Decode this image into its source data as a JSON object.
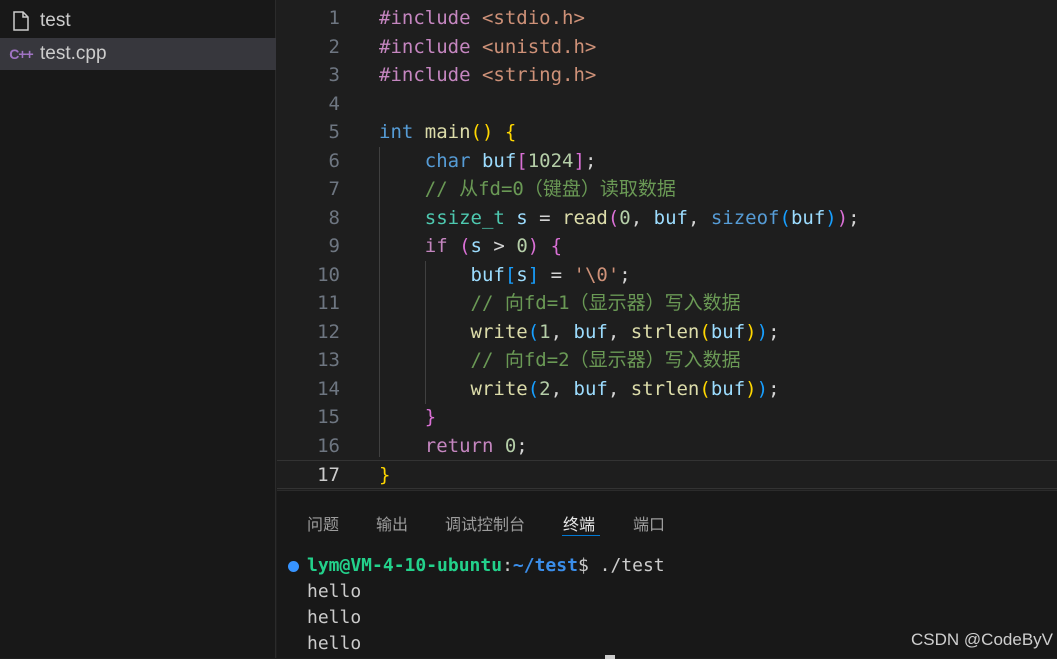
{
  "explorer": {
    "files": [
      {
        "name": "test",
        "icon": "file-icon"
      },
      {
        "name": "test.cpp",
        "icon": "cpp-file-icon",
        "icon_text": "C++",
        "selected": true
      }
    ]
  },
  "editor": {
    "current_line": 17,
    "lines": [
      {
        "n": "1",
        "tokens": [
          {
            "t": "#include ",
            "c": "pp"
          },
          {
            "t": "<stdio.h>",
            "c": "inc"
          }
        ]
      },
      {
        "n": "2",
        "tokens": [
          {
            "t": "#include ",
            "c": "pp"
          },
          {
            "t": "<unistd.h>",
            "c": "inc"
          }
        ]
      },
      {
        "n": "3",
        "tokens": [
          {
            "t": "#include ",
            "c": "pp"
          },
          {
            "t": "<string.h>",
            "c": "inc"
          }
        ]
      },
      {
        "n": "4",
        "tokens": []
      },
      {
        "n": "5",
        "tokens": [
          {
            "t": "int ",
            "c": "kw"
          },
          {
            "t": "main",
            "c": "fn"
          },
          {
            "t": "() ",
            "c": "p1"
          },
          {
            "t": "{",
            "c": "p1"
          }
        ]
      },
      {
        "n": "6",
        "tokens": [
          {
            "t": "    char ",
            "c": "kw"
          },
          {
            "t": "buf",
            "c": "var"
          },
          {
            "t": "[",
            "c": "p2"
          },
          {
            "t": "1024",
            "c": "num"
          },
          {
            "t": "]",
            "c": "p2"
          },
          {
            "t": ";",
            "c": "op"
          }
        ]
      },
      {
        "n": "7",
        "tokens": [
          {
            "t": "    // 从fd=0（键盘）读取数据",
            "c": "cmt"
          }
        ]
      },
      {
        "n": "8",
        "tokens": [
          {
            "t": "    ssize_t ",
            "c": "typ"
          },
          {
            "t": "s ",
            "c": "var"
          },
          {
            "t": "= ",
            "c": "op"
          },
          {
            "t": "read",
            "c": "fn"
          },
          {
            "t": "(",
            "c": "p2"
          },
          {
            "t": "0",
            "c": "num"
          },
          {
            "t": ", ",
            "c": "op"
          },
          {
            "t": "buf",
            "c": "var"
          },
          {
            "t": ", ",
            "c": "op"
          },
          {
            "t": "sizeof",
            "c": "kw"
          },
          {
            "t": "(",
            "c": "p3"
          },
          {
            "t": "buf",
            "c": "var"
          },
          {
            "t": ")",
            "c": "p3"
          },
          {
            "t": ")",
            "c": "p2"
          },
          {
            "t": ";",
            "c": "op"
          }
        ]
      },
      {
        "n": "9",
        "tokens": [
          {
            "t": "    if ",
            "c": "pp"
          },
          {
            "t": "(",
            "c": "p2"
          },
          {
            "t": "s ",
            "c": "var"
          },
          {
            "t": "> ",
            "c": "op"
          },
          {
            "t": "0",
            "c": "num"
          },
          {
            "t": ") ",
            "c": "p2"
          },
          {
            "t": "{",
            "c": "p2"
          }
        ]
      },
      {
        "n": "10",
        "tokens": [
          {
            "t": "        buf",
            "c": "var"
          },
          {
            "t": "[",
            "c": "p3"
          },
          {
            "t": "s",
            "c": "var"
          },
          {
            "t": "] ",
            "c": "p3"
          },
          {
            "t": "= ",
            "c": "op"
          },
          {
            "t": "'\\0'",
            "c": "str"
          },
          {
            "t": ";",
            "c": "op"
          }
        ]
      },
      {
        "n": "11",
        "tokens": [
          {
            "t": "        // 向fd=1（显示器）写入数据",
            "c": "cmt"
          }
        ]
      },
      {
        "n": "12",
        "tokens": [
          {
            "t": "        write",
            "c": "fn"
          },
          {
            "t": "(",
            "c": "p3"
          },
          {
            "t": "1",
            "c": "num"
          },
          {
            "t": ", ",
            "c": "op"
          },
          {
            "t": "buf",
            "c": "var"
          },
          {
            "t": ", ",
            "c": "op"
          },
          {
            "t": "strlen",
            "c": "fn"
          },
          {
            "t": "(",
            "c": "p1"
          },
          {
            "t": "buf",
            "c": "var"
          },
          {
            "t": ")",
            "c": "p1"
          },
          {
            "t": ")",
            "c": "p3"
          },
          {
            "t": ";",
            "c": "op"
          }
        ]
      },
      {
        "n": "13",
        "tokens": [
          {
            "t": "        // 向fd=2（显示器）写入数据",
            "c": "cmt"
          }
        ]
      },
      {
        "n": "14",
        "tokens": [
          {
            "t": "        write",
            "c": "fn"
          },
          {
            "t": "(",
            "c": "p3"
          },
          {
            "t": "2",
            "c": "num"
          },
          {
            "t": ", ",
            "c": "op"
          },
          {
            "t": "buf",
            "c": "var"
          },
          {
            "t": ", ",
            "c": "op"
          },
          {
            "t": "strlen",
            "c": "fn"
          },
          {
            "t": "(",
            "c": "p1"
          },
          {
            "t": "buf",
            "c": "var"
          },
          {
            "t": ")",
            "c": "p1"
          },
          {
            "t": ")",
            "c": "p3"
          },
          {
            "t": ";",
            "c": "op"
          }
        ]
      },
      {
        "n": "15",
        "tokens": [
          {
            "t": "    }",
            "c": "p2"
          }
        ]
      },
      {
        "n": "16",
        "tokens": [
          {
            "t": "    return ",
            "c": "pp"
          },
          {
            "t": "0",
            "c": "num"
          },
          {
            "t": ";",
            "c": "op"
          }
        ]
      },
      {
        "n": "17",
        "tokens": [
          {
            "t": "}",
            "c": "p1"
          }
        ]
      }
    ]
  },
  "panel": {
    "tabs": [
      {
        "label": "问题",
        "name": "tab-problems"
      },
      {
        "label": "输出",
        "name": "tab-output"
      },
      {
        "label": "调试控制台",
        "name": "tab-debug-console"
      },
      {
        "label": "终端",
        "name": "tab-terminal",
        "active": true
      },
      {
        "label": "端口",
        "name": "tab-ports"
      }
    ],
    "terminal": {
      "prompt_user": "lym@VM-4-10-ubuntu",
      "prompt_sep": ":",
      "prompt_path": "~/test",
      "prompt_tail": "$ ./test",
      "output": [
        "hello",
        "hello",
        "hello"
      ]
    }
  },
  "watermark": "CSDN @CodeByV",
  "colors": {
    "editor_bg": "#1e1e1e",
    "sidebar_bg": "#181818",
    "selection_bg": "#37373d",
    "keyword": "#569cd6",
    "control": "#c586c0",
    "string": "#ce9178",
    "function": "#dcdcaa",
    "variable": "#9cdcfe",
    "type": "#4ec9b0",
    "number": "#b5cea8",
    "comment": "#6a9955",
    "accent": "#0078d4"
  }
}
